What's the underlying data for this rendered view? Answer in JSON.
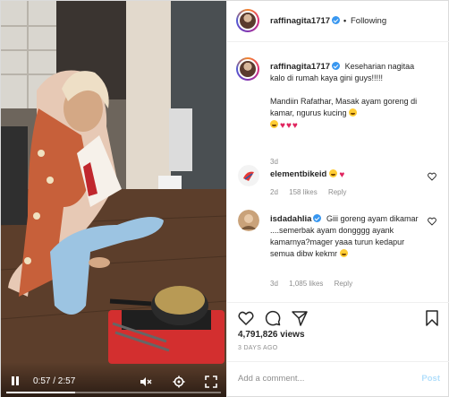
{
  "header": {
    "username": "raffinagita1717",
    "separator": "•",
    "follow_label": "Following",
    "more_label": "•••"
  },
  "video": {
    "time": "0:57 / 2:57",
    "progress": 0.32
  },
  "comments": [
    {
      "username": "raffinagita1717",
      "text": "Keseharian nagitaa kalo di rumah kaya gini guys!!!!!",
      "text2": "Mandiin Rafathar, Masak ayam goreng di kamar, ngurus kucing",
      "time": "3d"
    },
    {
      "username": "elementbikeid",
      "time": "2d",
      "likes": "158 likes",
      "reply": "Reply"
    },
    {
      "username": "isdadahlia",
      "text": "Giii goreng ayam dikamar ....semerbak ayam dongggg ayank kamarnya?mager yaaa turun kedapur semua dibw kekmr",
      "time": "3d",
      "likes": "1,085 likes",
      "reply": "Reply"
    }
  ],
  "stats": {
    "views": "4,791,826 views",
    "posted": "3 DAYS AGO"
  },
  "add_comment": {
    "placeholder": "Add a comment...",
    "post_label": "Post"
  },
  "icons": [
    "verified-badge-icon",
    "heart-icon",
    "comment-icon",
    "share-icon",
    "bookmark-icon",
    "play-pause-icon",
    "mute-icon",
    "settings-icon",
    "fullscreen-icon"
  ],
  "colors": {
    "accent": "#3897f0",
    "post_disabled": "#b2dffc",
    "heart": "#e0245e"
  }
}
